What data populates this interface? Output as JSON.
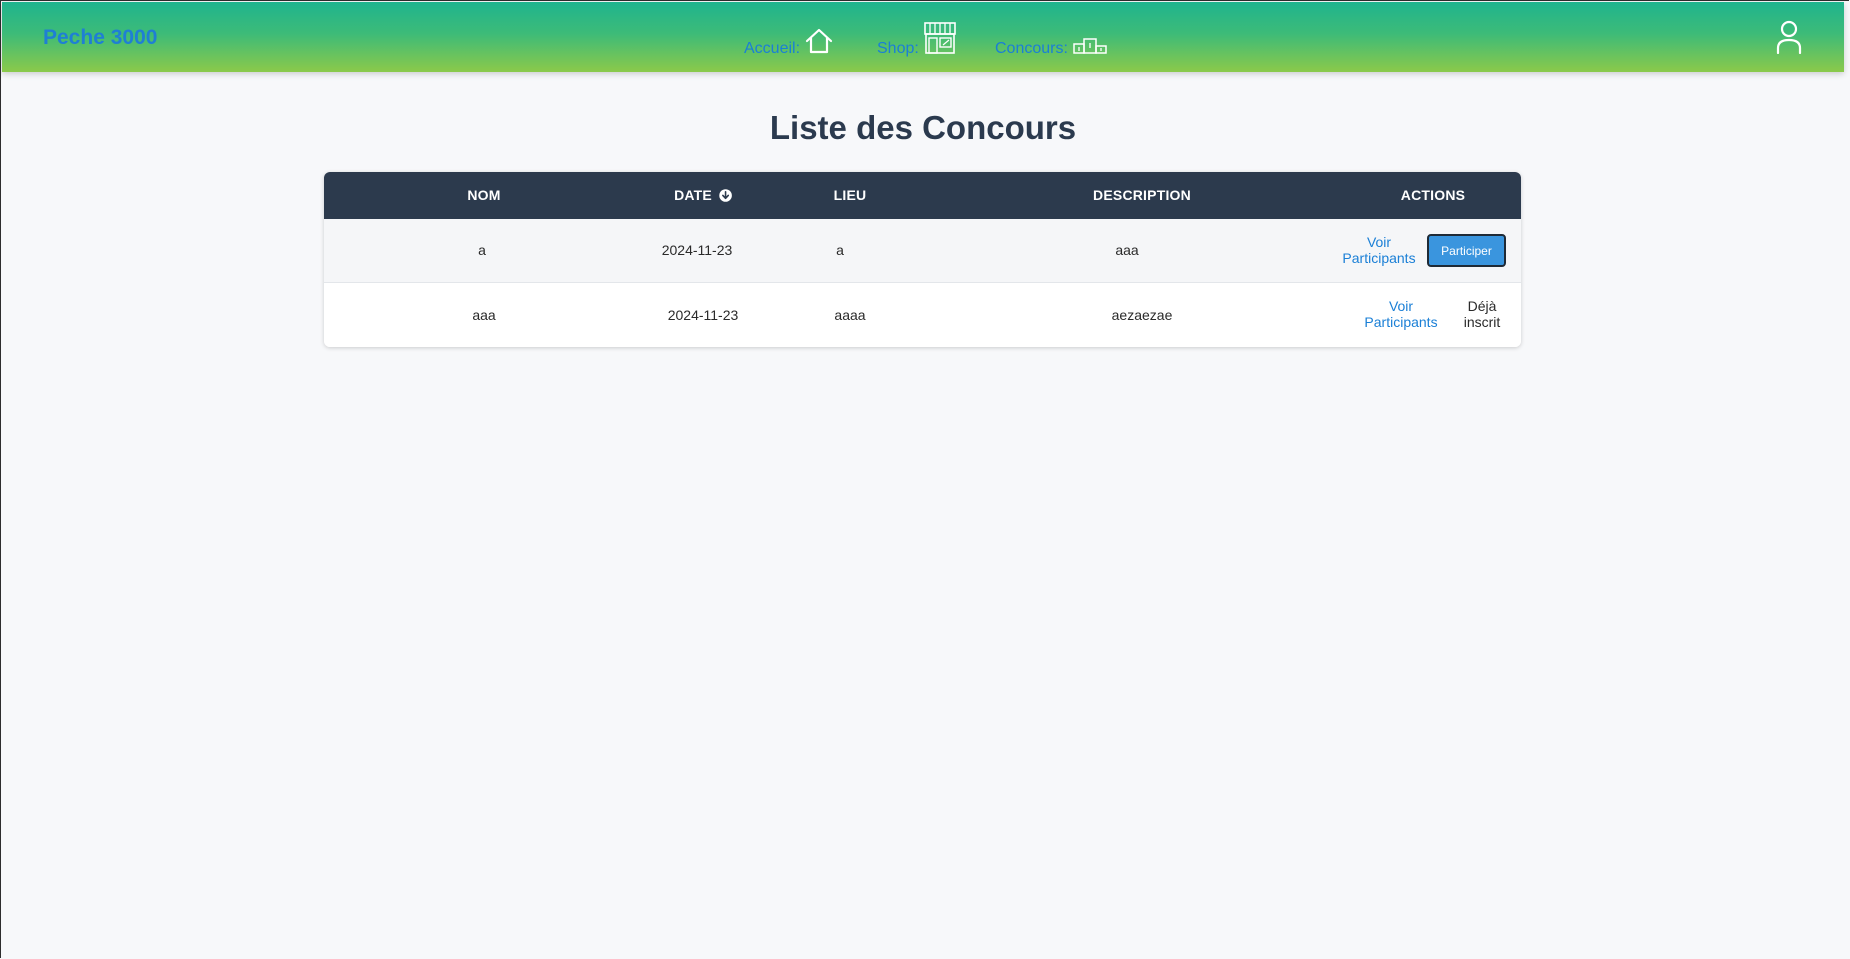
{
  "navbar": {
    "brand": "Peche 3000",
    "links": [
      {
        "label": "Accueil:",
        "icon": "home-icon"
      },
      {
        "label": "Shop:",
        "icon": "shop-icon"
      },
      {
        "label": "Concours:",
        "icon": "podium-icon"
      }
    ],
    "user_icon": "user-icon"
  },
  "page": {
    "title": "Liste des Concours"
  },
  "table": {
    "headers": {
      "nom": "NOM",
      "date": "DATE",
      "lieu": "LIEU",
      "description": "DESCRIPTION",
      "actions": "ACTIONS"
    },
    "sort_icon": "sort-down-icon",
    "rows": [
      {
        "nom": "a",
        "date": "2024-11-23",
        "lieu": "a",
        "description": "aaa",
        "voir_line1": "Voir",
        "voir_line2": "Participants",
        "action": "Participer"
      },
      {
        "nom": "aaa",
        "date": "2024-11-23",
        "lieu": "aaaa",
        "description": "aezaezae",
        "voir_line1": "Voir",
        "voir_line2": "Participants",
        "status_line1": "Déjà",
        "status_line2": "inscrit"
      }
    ]
  },
  "colors": {
    "navbar_top": "#1fb48e",
    "navbar_bottom": "#8bc94a",
    "link": "#1a7fd6",
    "table_header": "#2c3a4d",
    "button": "#3a95de"
  }
}
